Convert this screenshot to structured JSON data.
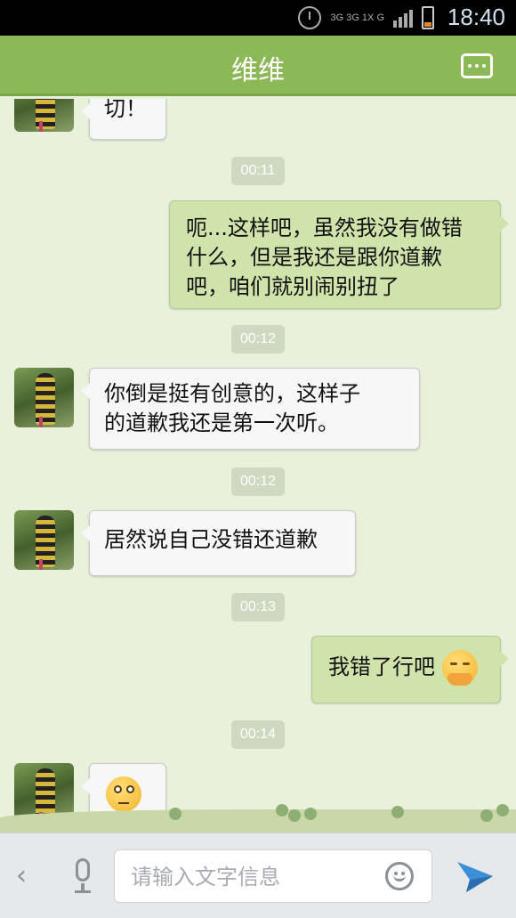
{
  "status_bar": {
    "time": "18:40",
    "network_label": "3G 3G 1X G",
    "icons": [
      "alarm-icon",
      "signal-icon",
      "battery-icon"
    ]
  },
  "header": {
    "title": "维维",
    "menu_icon": "more-icon"
  },
  "messages": [
    {
      "side": "left",
      "text": "切！"
    },
    {
      "timestamp": "00:11"
    },
    {
      "side": "right",
      "text_lines": [
        "呃...这样吧，虽然我没有做错",
        "什么，但是我还是跟你道歉",
        "吧，咱们就别闹别扭了"
      ]
    },
    {
      "timestamp": "00:12"
    },
    {
      "side": "left",
      "text_lines": [
        "你倒是挺有创意的，这样子",
        "的道歉我还是第一次听。"
      ]
    },
    {
      "timestamp": "00:12"
    },
    {
      "side": "left",
      "text": "居然说自己没错还道歉"
    },
    {
      "timestamp": "00:13"
    },
    {
      "side": "right",
      "text": "我错了行吧",
      "emoji": "blush-emoji"
    },
    {
      "timestamp": "00:14"
    },
    {
      "side": "left",
      "emoji": "puzzled-emoji"
    }
  ],
  "chat": {
    "msg1": "切！",
    "ts1": "00:11",
    "msg2_l1": "呃...这样吧，虽然我没有做错",
    "msg2_l2": "什么，但是我还是跟你道歉",
    "msg2_l3": "吧，咱们就别闹别扭了",
    "ts2": "00:12",
    "msg3_l1": "你倒是挺有创意的，这样子",
    "msg3_l2": "的道歉我还是第一次听。",
    "ts3": "00:12",
    "msg4": "居然说自己没错还道歉",
    "ts4": "00:13",
    "msg5": "我错了行吧",
    "ts5": "00:14"
  },
  "input_bar": {
    "placeholder": "请输入文字信息",
    "value": "",
    "icons": [
      "back-chevron-icon",
      "microphone-icon",
      "smiley-icon",
      "send-icon"
    ]
  },
  "colors": {
    "title_bar": "#8db857",
    "chat_background": "#e9f1dc",
    "incoming_bubble": "#f7f7f7",
    "outgoing_bubble": "#d0e3ab"
  }
}
